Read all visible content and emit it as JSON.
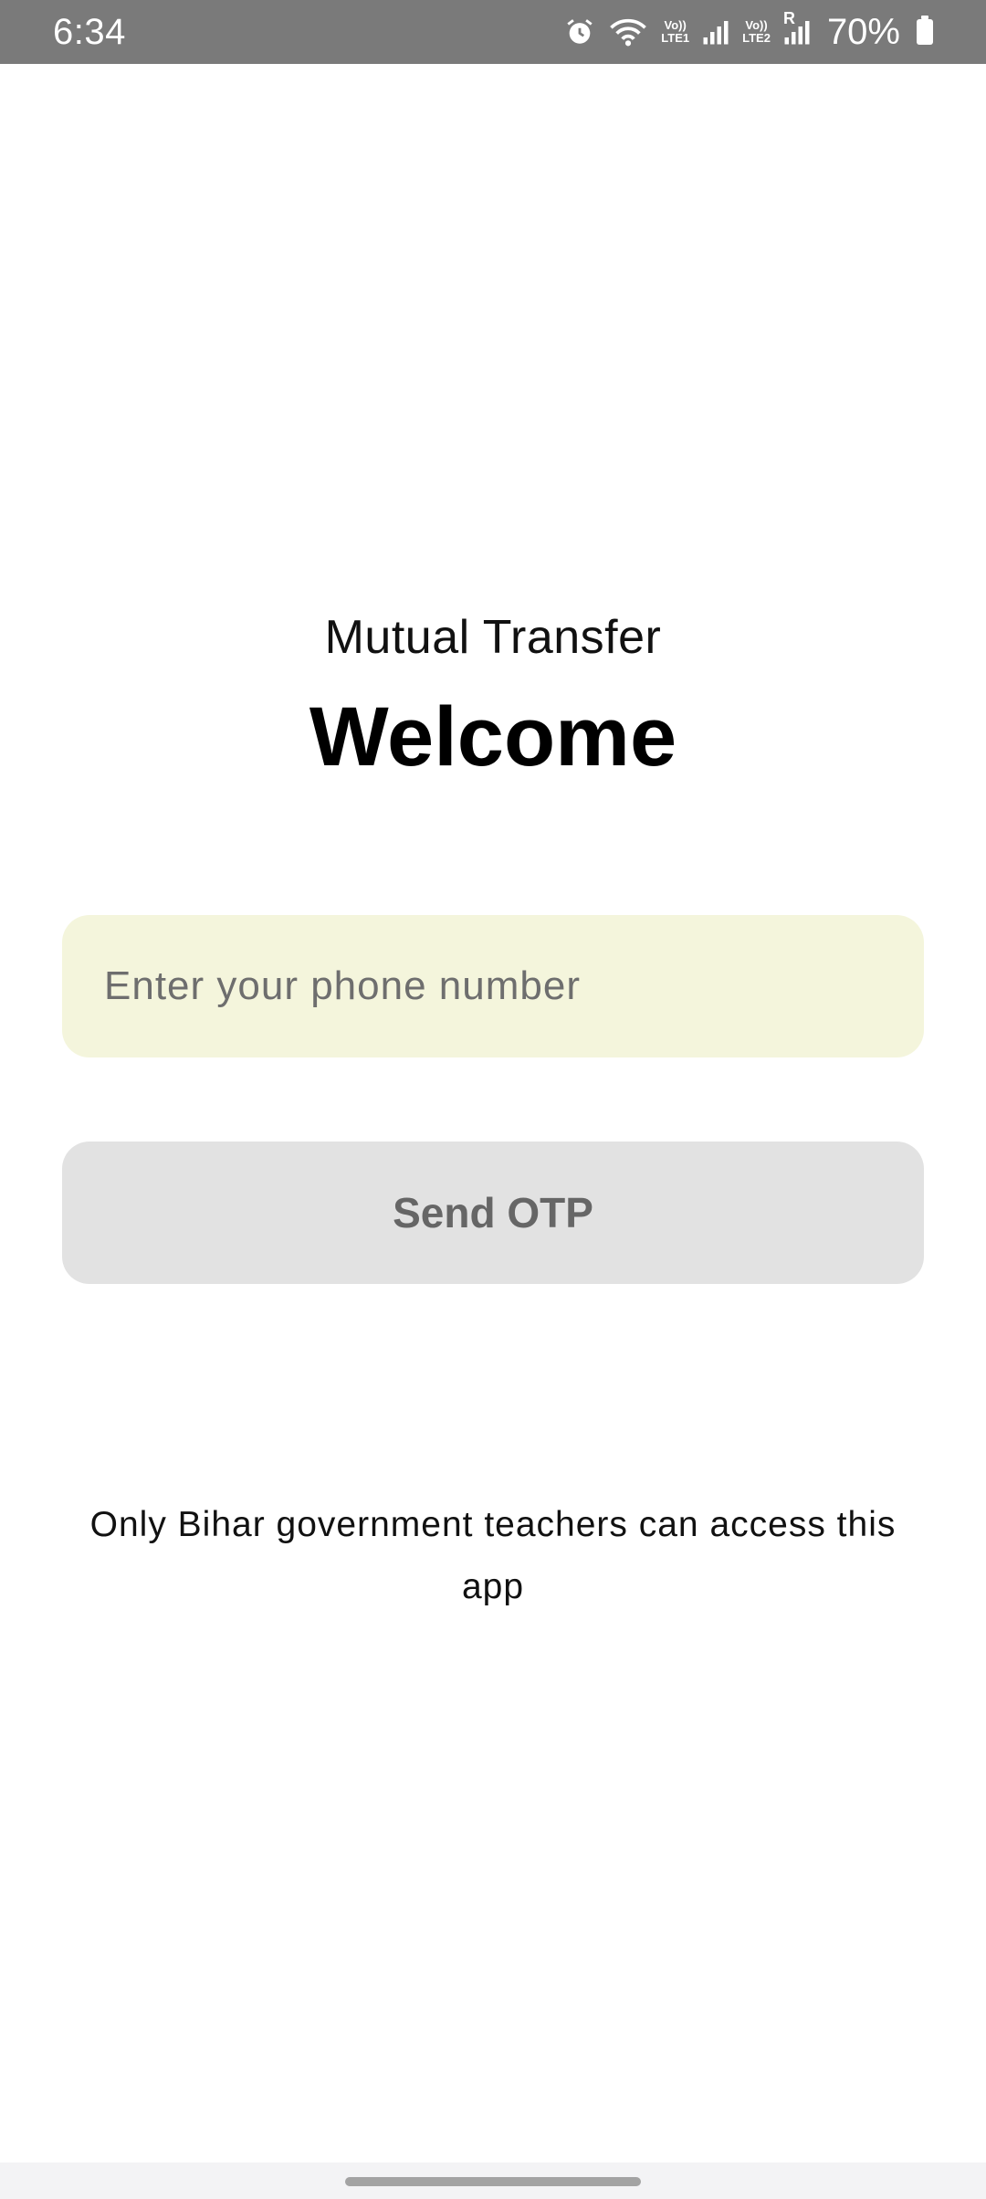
{
  "status_bar": {
    "time": "6:34",
    "net1_label_top": "Vo))",
    "net1_label_bottom": "LTE1",
    "net2_label_top": "Vo))",
    "net2_label_bottom": "LTE2",
    "roaming": "R",
    "battery_percent": "70%",
    "icons": [
      "alarm-icon",
      "wifi-icon",
      "signal-icon",
      "signal-icon",
      "battery-icon"
    ]
  },
  "header": {
    "app_title": "Mutual Transfer",
    "welcome": "Welcome"
  },
  "form": {
    "phone_placeholder": "Enter your phone number",
    "phone_value": "",
    "send_otp_label": "Send OTP"
  },
  "footer": {
    "note": "Only Bihar government teachers can access this app"
  },
  "colors": {
    "status_bar_bg": "#7a7a7a",
    "input_bg": "#f4f5dc",
    "button_bg": "#e2e2e2",
    "button_text": "#666666"
  }
}
